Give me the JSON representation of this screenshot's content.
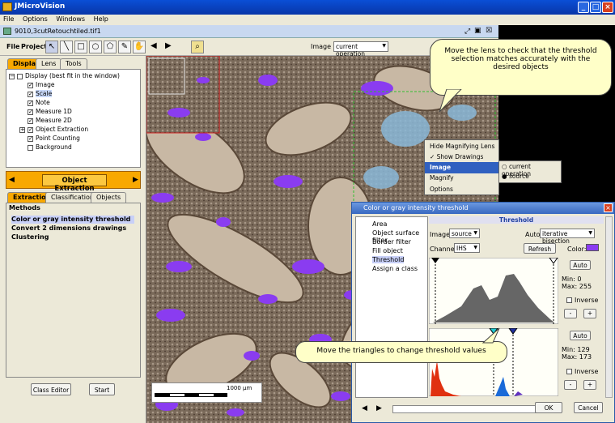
{
  "app": {
    "title": "JMicroVision"
  },
  "menu": [
    "File",
    "Options",
    "Windows",
    "Help"
  ],
  "document": {
    "title": "9010,3cutRetouchtiled.tif1"
  },
  "toolbar": {
    "file": "File",
    "project": "Project",
    "image_label": "Image :",
    "image_value": "current operation"
  },
  "left_tabs": [
    "Display",
    "Lens",
    "Tools"
  ],
  "display_tree": {
    "root": "Display (best fit in the window)",
    "items": [
      {
        "label": "Image",
        "checked": true
      },
      {
        "label": "Scale",
        "checked": true
      },
      {
        "label": "Note",
        "checked": true
      },
      {
        "label": "Measure 1D",
        "checked": true
      },
      {
        "label": "Measure 2D",
        "checked": true
      },
      {
        "label": "Object Extraction",
        "checked": true
      },
      {
        "label": "Point Counting",
        "checked": true
      },
      {
        "label": "Background",
        "checked": false
      }
    ]
  },
  "extraction_header": "Object Extraction",
  "extraction_tabs": [
    "Extraction",
    "Classification",
    "Objects"
  ],
  "methods": {
    "title": "Methods",
    "items": [
      "Color or gray intensity threshold",
      "Convert 2 dimensions drawings",
      "Clustering"
    ]
  },
  "bottom_buttons": {
    "class_editor": "Class Editor",
    "start": "Start"
  },
  "scale_bar": {
    "label": "1000 µm"
  },
  "context_menu": {
    "items": [
      "Hide Magnifying Lens",
      "Show Drawings",
      "Image",
      "Magnify",
      "Options"
    ],
    "submenu": [
      "current operation",
      "source"
    ]
  },
  "dialog": {
    "title": "Color or gray intensity threshold",
    "steps": [
      "Area",
      "Object surface filter",
      "Border filter",
      "Fill object",
      "Threshold",
      "Assign a class"
    ],
    "panel_title": "Threshold",
    "image_label": "Image:",
    "image_value": "source",
    "auto_label": "Auto:",
    "auto_value": "iterative bisection",
    "channel_label": "Channel:",
    "channel_value": "IHS",
    "refresh": "Refresh",
    "color_label": "Color:",
    "hist1": {
      "auto": "Auto",
      "min": "Min: 0",
      "max": "Max: 255",
      "inverse": "Inverse"
    },
    "hist2": {
      "auto": "Auto",
      "min": "Min: 129",
      "max": "Max: 173",
      "inverse": "Inverse"
    },
    "ok": "OK",
    "cancel": "Cancel"
  },
  "callouts": {
    "lens": "Move the lens to check that the threshold selection matches accurately with the desired objects",
    "triangles": "Move the triangles to change threshold values"
  },
  "colors": {
    "accent": "#8a3cf0",
    "title_blue": "#0a4fd6",
    "orange": "#f8a800"
  }
}
